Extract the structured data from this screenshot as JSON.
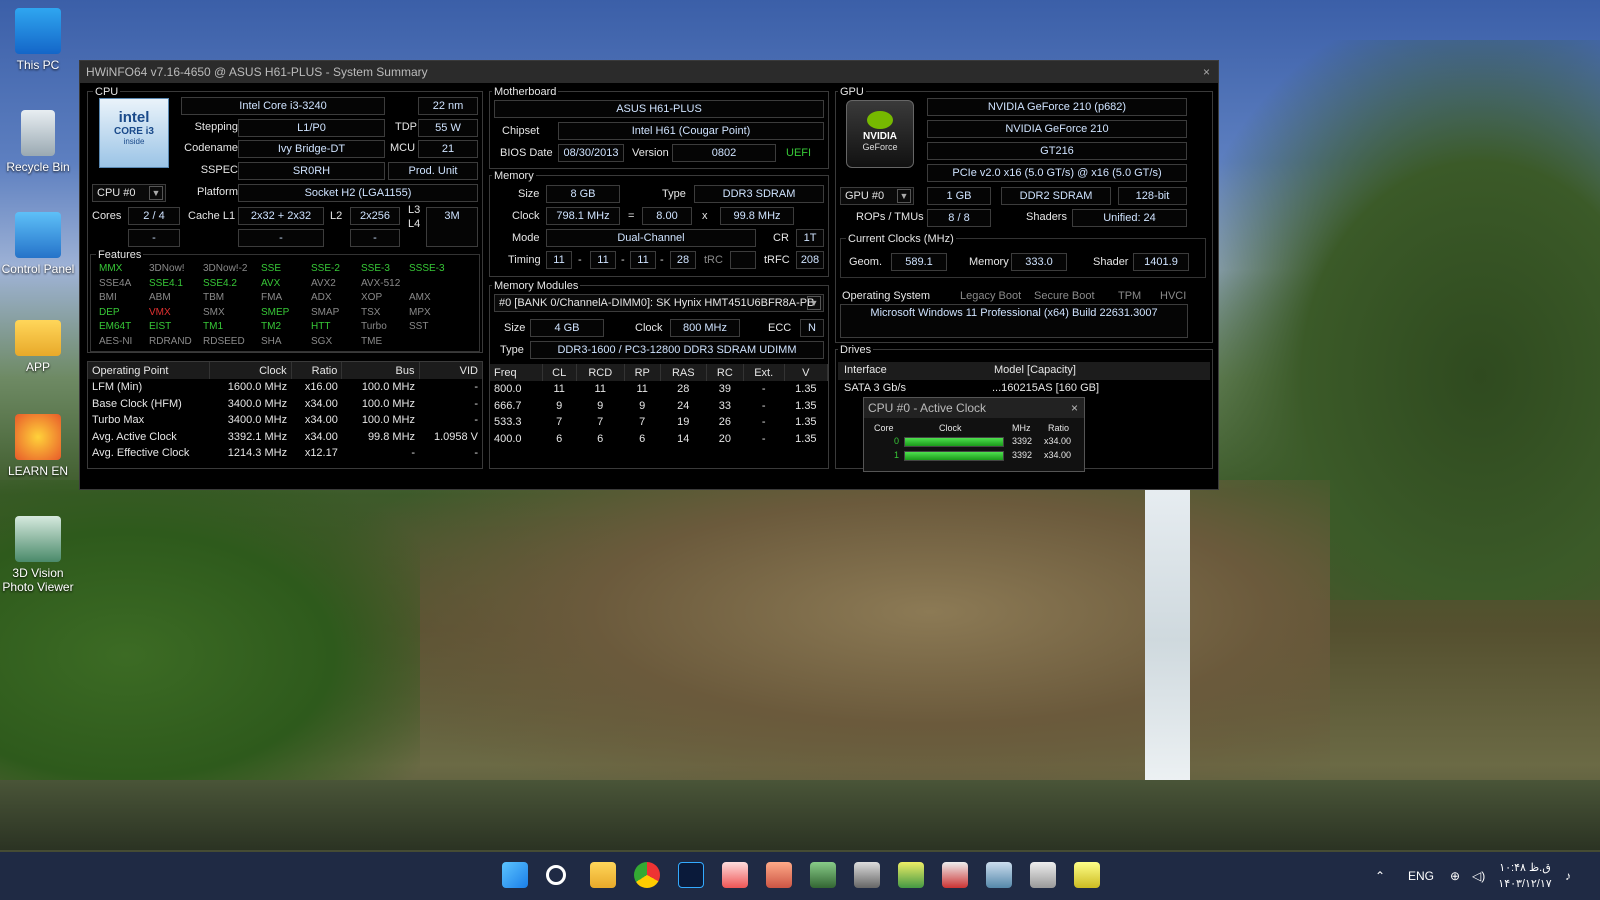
{
  "desktop_icons": [
    {
      "label": "This PC"
    },
    {
      "label": "Recycle Bin"
    },
    {
      "label": "Control Panel"
    },
    {
      "label": "APP"
    },
    {
      "label": "LEARN EN"
    },
    {
      "label": "3D Vision Photo Viewer"
    }
  ],
  "window": {
    "title": "HWiNFO64 v7.16-4650 @ ASUS H61-PLUS - System Summary",
    "close": "×"
  },
  "cpu": {
    "section": "CPU",
    "name": "Intel Core i3-3240",
    "nm": "22 nm",
    "stepping_label": "Stepping",
    "stepping": "L1/P0",
    "tdp_label": "TDP",
    "tdp": "55 W",
    "codename_label": "Codename",
    "codename": "Ivy Bridge-DT",
    "mcu_label": "MCU",
    "mcu": "21",
    "sspec_label": "SSPEC",
    "sspec": "SR0RH",
    "produnit": "Prod. Unit",
    "selector": "CPU #0",
    "platform_label": "Platform",
    "platform": "Socket H2 (LGA1155)",
    "cores_label": "Cores",
    "cores": "2 / 4",
    "cache_l1_label": "Cache L1",
    "cache_l1": "2x32 + 2x32",
    "l2_label": "L2",
    "l2": "2x256",
    "l3_label": "L3",
    "l3": "3M",
    "l4_label": "L4",
    "dash": "-",
    "logo_line1": "intel",
    "logo_line2": "CORE i3",
    "logo_line3": "inside"
  },
  "features": {
    "title": "Features",
    "items": [
      {
        "t": "MMX",
        "c": "green"
      },
      {
        "t": "3DNow!",
        "c": "gray"
      },
      {
        "t": "3DNow!-2",
        "c": "gray"
      },
      {
        "t": "SSE",
        "c": "green"
      },
      {
        "t": "SSE-2",
        "c": "green"
      },
      {
        "t": "SSE-3",
        "c": "green"
      },
      {
        "t": "SSSE-3",
        "c": "green"
      },
      {
        "t": "SSE4A",
        "c": "gray"
      },
      {
        "t": "SSE4.1",
        "c": "green"
      },
      {
        "t": "SSE4.2",
        "c": "green"
      },
      {
        "t": "AVX",
        "c": "green"
      },
      {
        "t": "AVX2",
        "c": "gray"
      },
      {
        "t": "AVX-512",
        "c": "gray"
      },
      {
        "t": "BMI",
        "c": "gray"
      },
      {
        "t": "ABM",
        "c": "gray"
      },
      {
        "t": "TBM",
        "c": "gray"
      },
      {
        "t": "FMA",
        "c": "gray"
      },
      {
        "t": "ADX",
        "c": "gray"
      },
      {
        "t": "XOP",
        "c": "gray"
      },
      {
        "t": "AMX",
        "c": "gray"
      },
      {
        "t": "DEP",
        "c": "green"
      },
      {
        "t": "VMX",
        "c": "red"
      },
      {
        "t": "SMX",
        "c": "gray"
      },
      {
        "t": "SMEP",
        "c": "green"
      },
      {
        "t": "SMAP",
        "c": "gray"
      },
      {
        "t": "TSX",
        "c": "gray"
      },
      {
        "t": "MPX",
        "c": "gray"
      },
      {
        "t": "EM64T",
        "c": "green"
      },
      {
        "t": "EIST",
        "c": "green"
      },
      {
        "t": "TM1",
        "c": "green"
      },
      {
        "t": "TM2",
        "c": "green"
      },
      {
        "t": "HTT",
        "c": "green"
      },
      {
        "t": "Turbo",
        "c": "gray"
      },
      {
        "t": "SST",
        "c": "gray"
      },
      {
        "t": "AES-NI",
        "c": "gray"
      },
      {
        "t": "RDRAND",
        "c": "gray"
      },
      {
        "t": "RDSEED",
        "c": "gray"
      },
      {
        "t": "SHA",
        "c": "gray"
      },
      {
        "t": "SGX",
        "c": "gray"
      },
      {
        "t": "TME",
        "c": "gray"
      }
    ]
  },
  "op_table": {
    "headers": [
      "Operating Point",
      "Clock",
      "Ratio",
      "Bus",
      "VID"
    ],
    "rows": [
      [
        "LFM (Min)",
        "1600.0 MHz",
        "x16.00",
        "100.0 MHz",
        "-"
      ],
      [
        "Base Clock (HFM)",
        "3400.0 MHz",
        "x34.00",
        "100.0 MHz",
        "-"
      ],
      [
        "Turbo Max",
        "3400.0 MHz",
        "x34.00",
        "100.0 MHz",
        "-"
      ],
      [
        "Avg. Active Clock",
        "3392.1 MHz",
        "x34.00",
        "99.8 MHz",
        "1.0958 V"
      ],
      [
        "Avg. Effective Clock",
        "1214.3 MHz",
        "x12.17",
        "-",
        "-"
      ]
    ]
  },
  "motherboard": {
    "section": "Motherboard",
    "name": "ASUS H61-PLUS",
    "chipset_label": "Chipset",
    "chipset": "Intel H61 (Cougar Point)",
    "bios_label": "BIOS Date",
    "bios_date": "08/30/2013",
    "version_label": "Version",
    "version": "0802",
    "uefi": "UEFI"
  },
  "memory": {
    "section": "Memory",
    "size_label": "Size",
    "size": "8 GB",
    "type_label": "Type",
    "type": "DDR3 SDRAM",
    "clock_label": "Clock",
    "clock": "798.1 MHz",
    "eq": "=",
    "mult": "8.00",
    "x": "x",
    "bus": "99.8 MHz",
    "mode_label": "Mode",
    "mode": "Dual-Channel",
    "cr_label": "CR",
    "cr": "1T",
    "timing_label": "Timing",
    "t1": "11",
    "t2": "11",
    "t3": "11",
    "t4": "28",
    "trc_label": "tRC",
    "trc": "",
    "trfc_label": "tRFC",
    "trfc": "208",
    "dash": "-"
  },
  "modules": {
    "section": "Memory Modules",
    "selected": "#0 [BANK 0/ChannelA-DIMM0]: SK Hynix HMT451U6BFR8A-PB",
    "size_label": "Size",
    "size": "4 GB",
    "clock_label": "Clock",
    "clock": "800 MHz",
    "ecc_label": "ECC",
    "ecc": "N",
    "type_label": "Type",
    "type": "DDR3-1600 / PC3-12800 DDR3 SDRAM UDIMM",
    "headers": [
      "Freq",
      "CL",
      "RCD",
      "RP",
      "RAS",
      "RC",
      "Ext.",
      "V"
    ],
    "rows": [
      [
        "800.0",
        "11",
        "11",
        "11",
        "28",
        "39",
        "-",
        "1.35"
      ],
      [
        "666.7",
        "9",
        "9",
        "9",
        "24",
        "33",
        "-",
        "1.35"
      ],
      [
        "533.3",
        "7",
        "7",
        "7",
        "19",
        "26",
        "-",
        "1.35"
      ],
      [
        "400.0",
        "6",
        "6",
        "6",
        "14",
        "20",
        "-",
        "1.35"
      ]
    ]
  },
  "gpu": {
    "section": "GPU",
    "name1": "NVIDIA GeForce 210 (p682)",
    "name2": "NVIDIA GeForce 210",
    "chip": "GT216",
    "pcie": "PCIe v2.0 x16 (5.0 GT/s) @ x16 (5.0 GT/s)",
    "selector": "GPU #0",
    "mem": "1 GB",
    "memtype": "DDR2 SDRAM",
    "bus": "128-bit",
    "rops_label": "ROPs / TMUs",
    "rops": "8 / 8",
    "shaders_label": "Shaders",
    "shaders": "Unified: 24",
    "clocks_title": "Current Clocks (MHz)",
    "geom_label": "Geom.",
    "geom": "589.1",
    "memory_label": "Memory",
    "memory": "333.0",
    "shader_label": "Shader",
    "shader": "1401.9",
    "logo1": "NVIDIA",
    "logo2": "GeForce"
  },
  "os": {
    "section": "Operating System",
    "legacy": "Legacy Boot",
    "secure": "Secure Boot",
    "tpm": "TPM",
    "hvci": "HVCI",
    "name": "Microsoft Windows 11 Professional (x64) Build 22631.3007"
  },
  "drives": {
    "section": "Drives",
    "headers": [
      "Interface",
      "Model [Capacity]"
    ],
    "row_iface": "SATA 3 Gb/s",
    "row_model": "...160215AS [160 GB]"
  },
  "popup": {
    "title": "CPU #0 - Active Clock",
    "close": "×",
    "headers": [
      "Core",
      "Clock",
      "MHz",
      "Ratio"
    ],
    "rows": [
      {
        "core": "0",
        "mhz": "3392",
        "ratio": "x34.00",
        "fill": 1.0
      },
      {
        "core": "1",
        "mhz": "3392",
        "ratio": "x34.00",
        "fill": 1.0
      }
    ]
  },
  "taskbar": {
    "lang": "ENG",
    "time": "۱۰:۴۸ ق.ظ",
    "date": "۱۴۰۳/۱۲/۱۷"
  }
}
